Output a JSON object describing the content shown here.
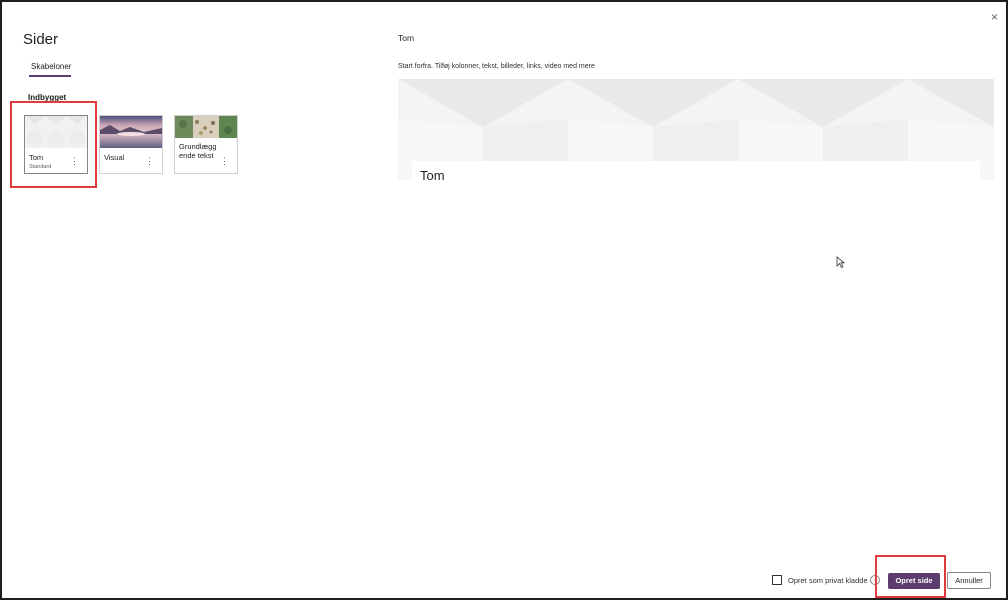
{
  "dialog": {
    "title": "Sider",
    "close_icon": "×"
  },
  "tabs": [
    {
      "label": "Skabeloner"
    }
  ],
  "section_label": "Indbygget",
  "templates": [
    {
      "name": "Tom",
      "subtitle": "Standard",
      "more_icon": "⋮",
      "selected": true
    },
    {
      "name": "Visual",
      "more_icon": "⋮"
    },
    {
      "name_line1": "Grundlægg",
      "name_line2": "ende tekst",
      "more_icon": "⋮"
    }
  ],
  "preview": {
    "title": "Tom",
    "description": "Start forfra. Tilføj kolonner, tekst, billeder, links, video med mere",
    "banner_title": "Tom"
  },
  "footer": {
    "private_draft_label": "Opret som privat kladde",
    "info_icon": "i",
    "create_button": "Opret side",
    "cancel_button": "Annuller"
  },
  "colors": {
    "accent": "#5c3b6f",
    "highlight": "#e0393e"
  }
}
